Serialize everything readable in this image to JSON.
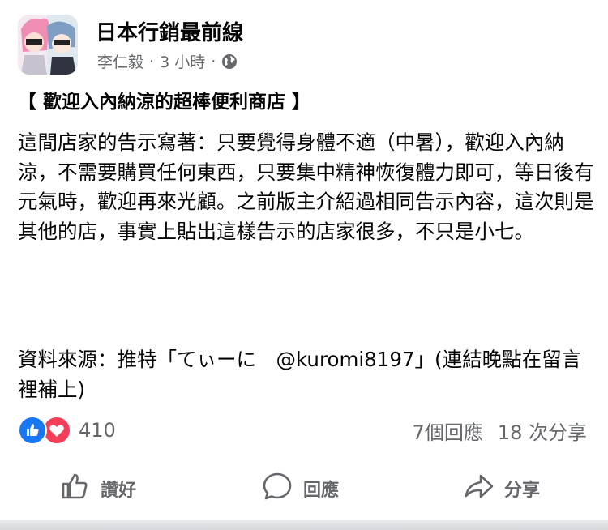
{
  "header": {
    "page_name": "日本行銷最前線",
    "author": "李仁毅",
    "separator": "·",
    "time": "3 小時",
    "privacy_icon": "globe-icon"
  },
  "post": {
    "title": "【 歡迎入內納涼的超棒便利商店 】",
    "body": "這間店家的告示寫著：只要覺得身體不適（中暑），歡迎入內納涼，不需要購買任何東西，只要集中精神恢復體力即可，等日後有元氣時，歡迎再來光顧。之前版主介紹過相同告示內容，這次則是其他的店，事實上貼出這樣告示的店家很多，不只是小七。",
    "source": "資料來源：推特「てぃーに　@kuromi8197」(連結晚點在留言裡補上)"
  },
  "engagement": {
    "reaction_count": "410",
    "comments": "7個回應",
    "shares": "18 次分享",
    "reaction_icons": [
      "like-icon",
      "love-icon"
    ]
  },
  "actions": {
    "like_label": "讚好",
    "comment_label": "回應",
    "share_label": "分享"
  },
  "colors": {
    "like_blue": "#1877f2",
    "love_red": "#f33e58",
    "secondary_text": "#65676b"
  }
}
